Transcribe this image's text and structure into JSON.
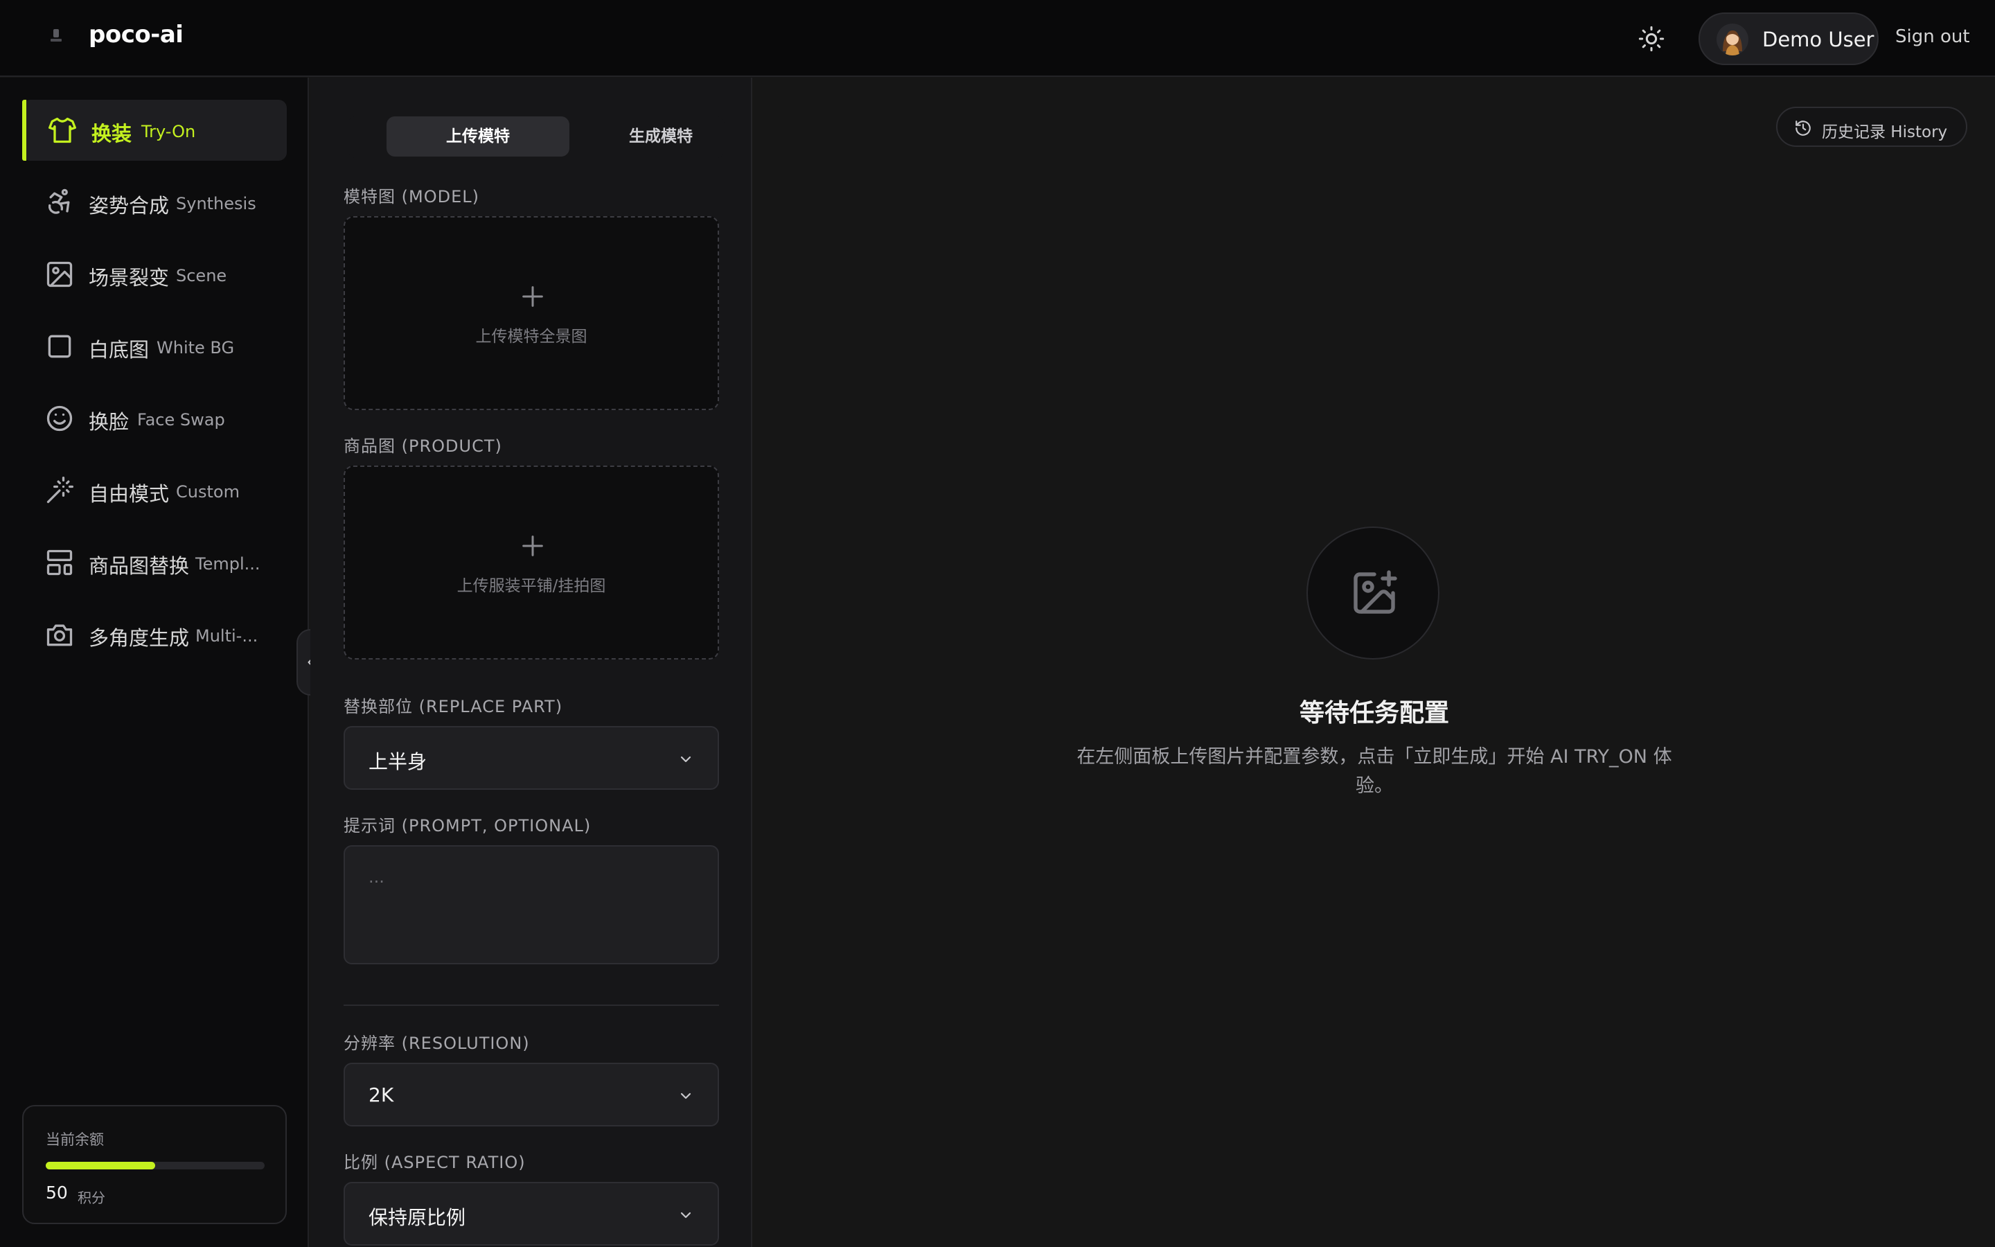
{
  "app": {
    "name": "poco-ai"
  },
  "header": {
    "user_name": "Demo User",
    "sign_out": "Sign out"
  },
  "sidebar": {
    "items": [
      {
        "zh": "换装",
        "en": "Try-On",
        "icon": "tshirt-icon",
        "active": true
      },
      {
        "zh": "姿势合成",
        "en": "Synthesis",
        "icon": "accessibility-icon",
        "active": false
      },
      {
        "zh": "场景裂变",
        "en": "Scene",
        "icon": "image-icon",
        "active": false
      },
      {
        "zh": "白底图",
        "en": "White BG",
        "icon": "square-icon",
        "active": false
      },
      {
        "zh": "换脸",
        "en": "Face Swap",
        "icon": "smile-icon",
        "active": false
      },
      {
        "zh": "自由模式",
        "en": "Custom",
        "icon": "magic-wand-icon",
        "active": false
      },
      {
        "zh": "商品图替换",
        "en": "Templ...",
        "icon": "layout-icon",
        "active": false
      },
      {
        "zh": "多角度生成",
        "en": "Multi-...",
        "icon": "camera-icon",
        "active": false
      }
    ],
    "balance": {
      "label": "当前余额",
      "value": "50",
      "unit": "积分",
      "fraction": 0.5
    }
  },
  "panel": {
    "tabs": {
      "upload": "上传模特",
      "generate": "生成模特"
    },
    "model_label": "模特图 (MODEL)",
    "model_hint": "上传模特全景图",
    "product_label": "商品图 (PRODUCT)",
    "product_hint": "上传服装平铺/挂拍图",
    "replace_label": "替换部位 (REPLACE PART)",
    "replace_value": "上半身",
    "prompt_label": "提示词 (PROMPT, OPTIONAL)",
    "prompt_placeholder": "...",
    "resolution_label": "分辨率 (RESOLUTION)",
    "resolution_value": "2K",
    "ratio_label": "比例 (ASPECT RATIO)",
    "ratio_value": "保持原比例"
  },
  "main": {
    "history": "历史记录 History",
    "empty_title": "等待任务配置",
    "empty_desc": "在左侧面板上传图片并配置参数，点击「立即生成」开始 AI TRY_ON 体验。"
  },
  "colors": {
    "accent": "#c4f11f",
    "background": "#161616",
    "sidebar": "#0c0c0d"
  }
}
